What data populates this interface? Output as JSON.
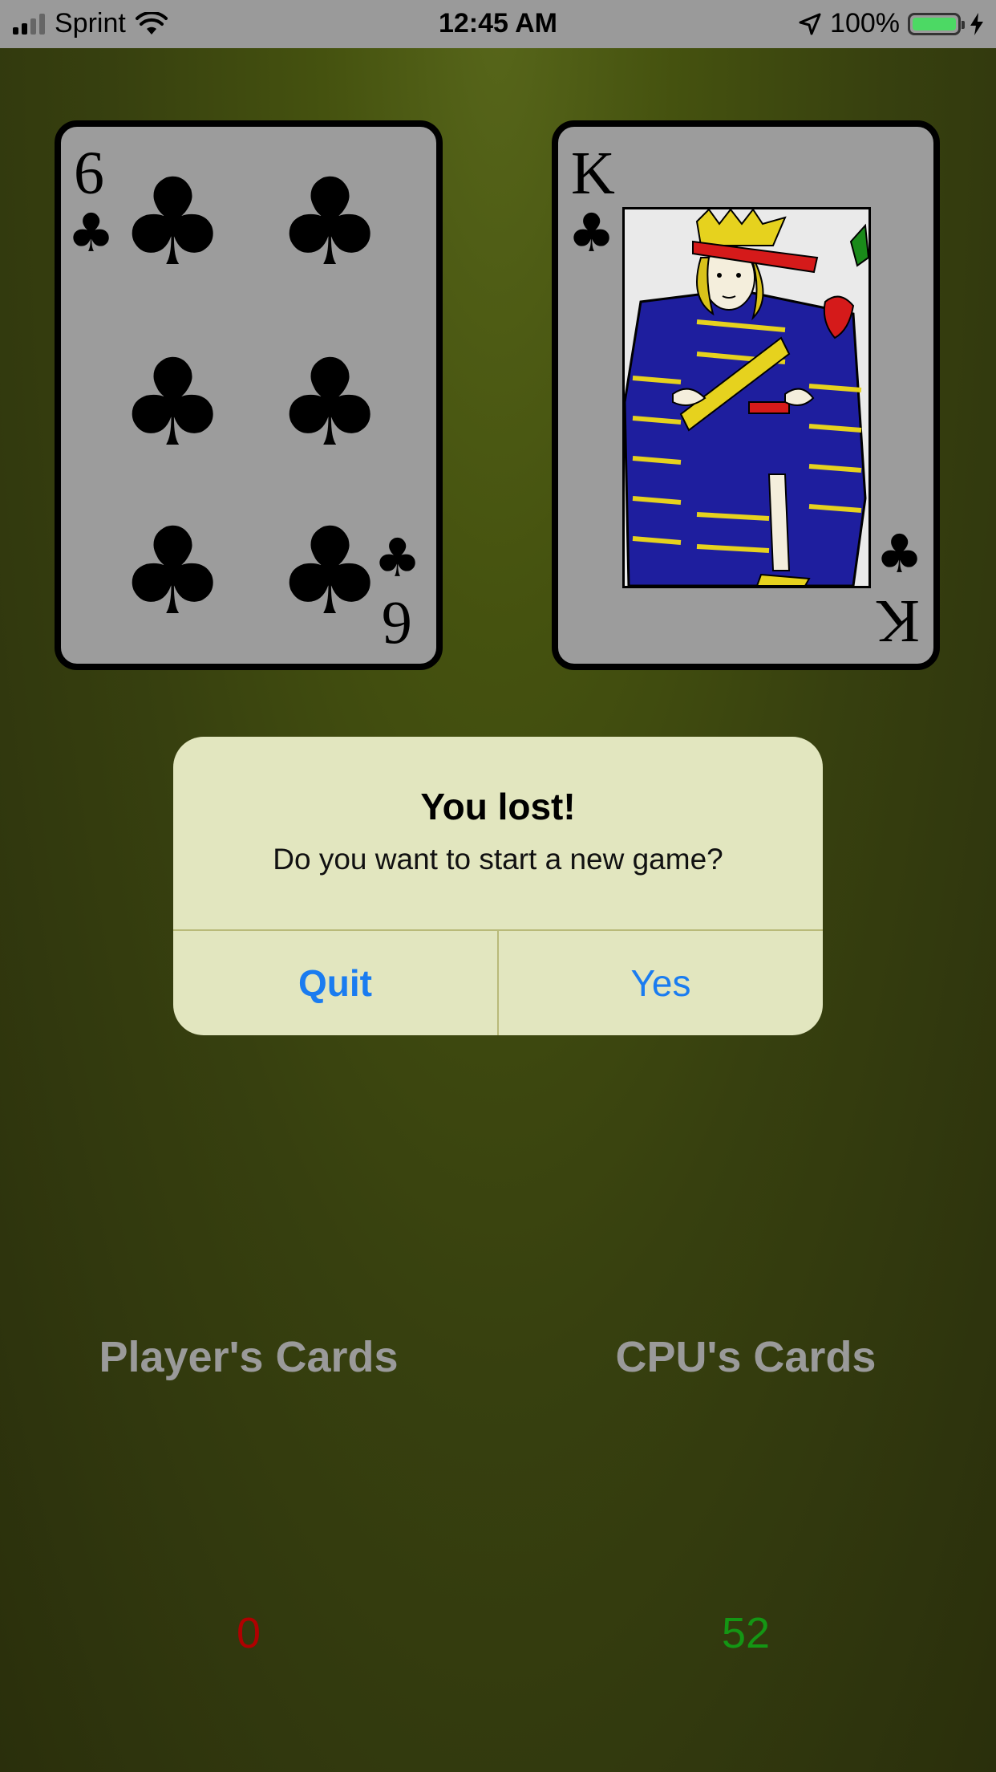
{
  "status": {
    "carrier": "Sprint",
    "time": "12:45 AM",
    "battery_percent": "100%"
  },
  "cards": {
    "player": {
      "rank": "6",
      "suit": "clubs",
      "suit_glyph": "♣"
    },
    "cpu": {
      "rank": "K",
      "suit": "clubs",
      "suit_glyph": "♣"
    }
  },
  "alert": {
    "title": "You lost!",
    "message": "Do you want to start a new game?",
    "quit_label": "Quit",
    "yes_label": "Yes"
  },
  "scores": {
    "player_label": "Player's Cards",
    "cpu_label": "CPU's Cards",
    "player_count": "0",
    "cpu_count": "52",
    "player_color": "#b00000",
    "cpu_color": "#149614"
  },
  "colors": {
    "button_blue": "#1a7cf0",
    "battery_green": "#4cd964"
  }
}
